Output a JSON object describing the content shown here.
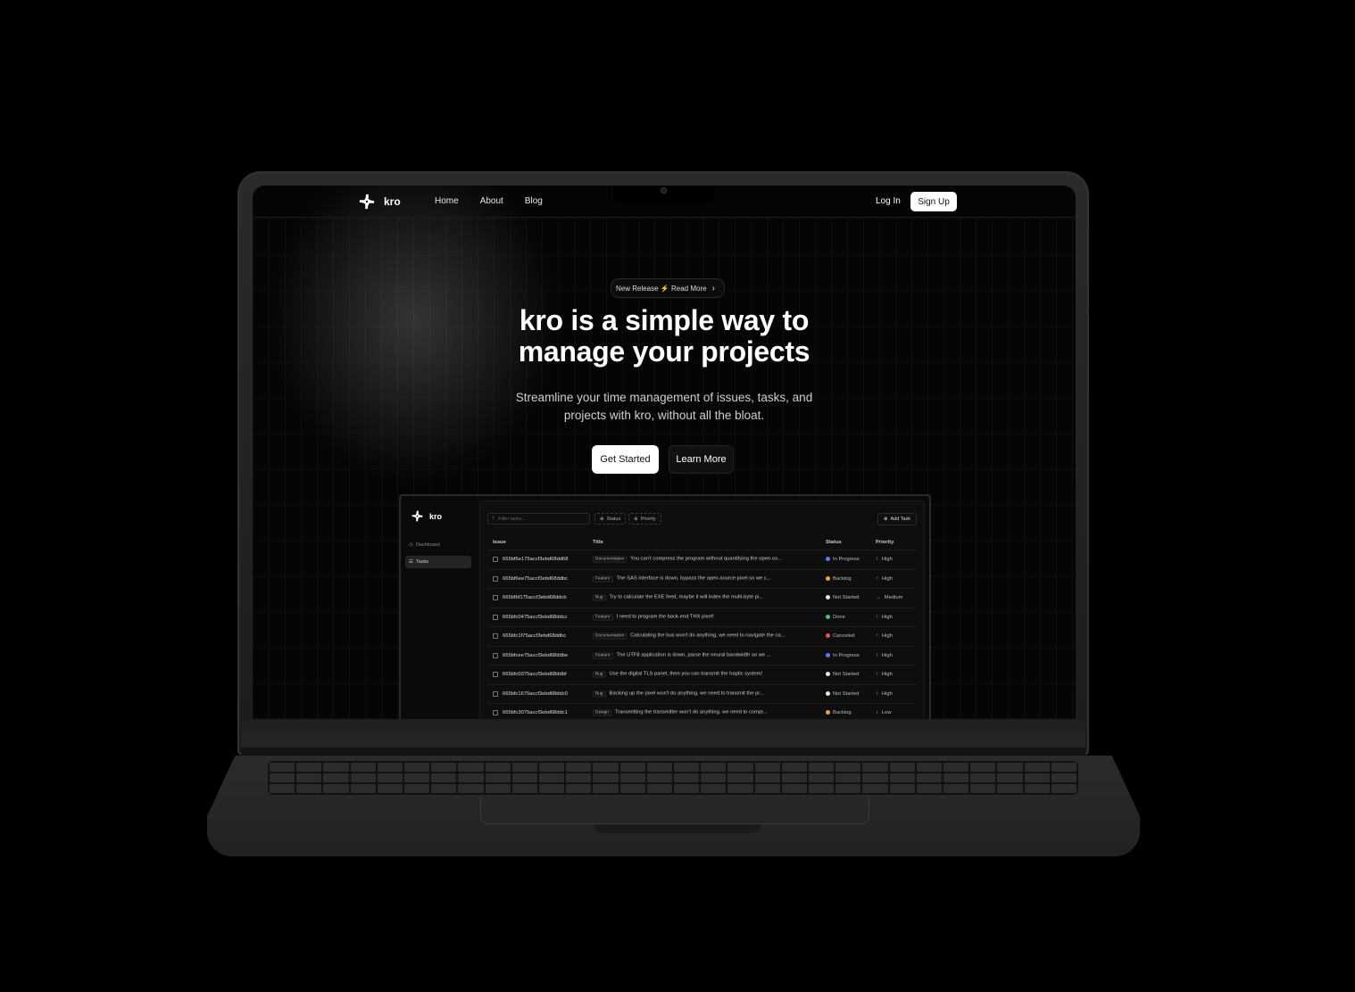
{
  "nav": {
    "logo_text": "kro",
    "links": [
      "Home",
      "About",
      "Blog"
    ],
    "login": "Log In",
    "signup": "Sign Up"
  },
  "hero": {
    "pill": "New Release ⚡ Read More",
    "title_line1": "kro is a simple way to",
    "title_line2": "manage your projects",
    "subtitle_line1": "Streamline your time management of issues, tasks, and",
    "subtitle_line2": "projects with kro, without all the bloat.",
    "cta_primary": "Get Started",
    "cta_secondary": "Learn More"
  },
  "app": {
    "logo_text": "kro",
    "sidebar": [
      "Dashboard",
      "Tasks"
    ],
    "filter_placeholder": "Filter tasks...",
    "chips": [
      "Status",
      "Priority"
    ],
    "add_task": "Add Task",
    "columns": [
      "Issue",
      "Title",
      "Status",
      "Priority"
    ],
    "rows": [
      {
        "id": "665bf6e175accf3ebd68dd68",
        "label": "Documentation",
        "title": "You can't compress the program without quantifying the open-so...",
        "status": "In Progress",
        "status_color": "#5b7cf5",
        "priority": "High",
        "arrow": "↑"
      },
      {
        "id": "665bf6ee75accf3ebd68ddbc",
        "label": "Feature",
        "title": "The SAS interface is down, bypass the open-source pixel so we c...",
        "status": "Backlog",
        "status_color": "#e0a64a",
        "priority": "High",
        "arrow": "↑"
      },
      {
        "id": "665bfbf175accf3ebd68ddcb",
        "label": "Bug",
        "title": "Try to calculate the EXE feed, maybe it will index the multi-byte pi...",
        "status": "Not Started",
        "status_color": "#e6e6e6",
        "priority": "Medium",
        "arrow": "→"
      },
      {
        "id": "665bfc0475accf3ebd68ddcc",
        "label": "Feature",
        "title": "I need to program the back-end THX pixel!",
        "status": "Done",
        "status_color": "#4fbf6a",
        "priority": "High",
        "arrow": "↑"
      },
      {
        "id": "665bfc1f75accf3ebd68ddbc",
        "label": "Documentation",
        "title": "Calculating the bus won't do anything, we need to navigate the ca...",
        "status": "Canceled",
        "status_color": "#e05555",
        "priority": "High",
        "arrow": "↑"
      },
      {
        "id": "665bfcee75accf3ebd68ddbe",
        "label": "Feature",
        "title": "The UTF8 application is down, parse the neural bandwidth so we ...",
        "status": "In Progress",
        "status_color": "#5b7cf5",
        "priority": "High",
        "arrow": "↑"
      },
      {
        "id": "665bfc0375accf3ebd68ddbf",
        "label": "Bug",
        "title": "Use the digital TLS panel, then you can transmit the haptic system!",
        "status": "Not Started",
        "status_color": "#e6e6e6",
        "priority": "High",
        "arrow": "↑"
      },
      {
        "id": "665bfc1675accf3ebd68ddc0",
        "label": "Bug",
        "title": "Backing up the pixel won't do anything, we need to transmit the pr...",
        "status": "Not Started",
        "status_color": "#e6e6e6",
        "priority": "High",
        "arrow": "↑"
      },
      {
        "id": "665bfc3075accf3ebd68ddc1",
        "label": "Design",
        "title": "Transmitting the transmitter won't do anything, we need to compr...",
        "status": "Backlog",
        "status_color": "#e0a64a",
        "priority": "Low",
        "arrow": "↓"
      }
    ]
  }
}
